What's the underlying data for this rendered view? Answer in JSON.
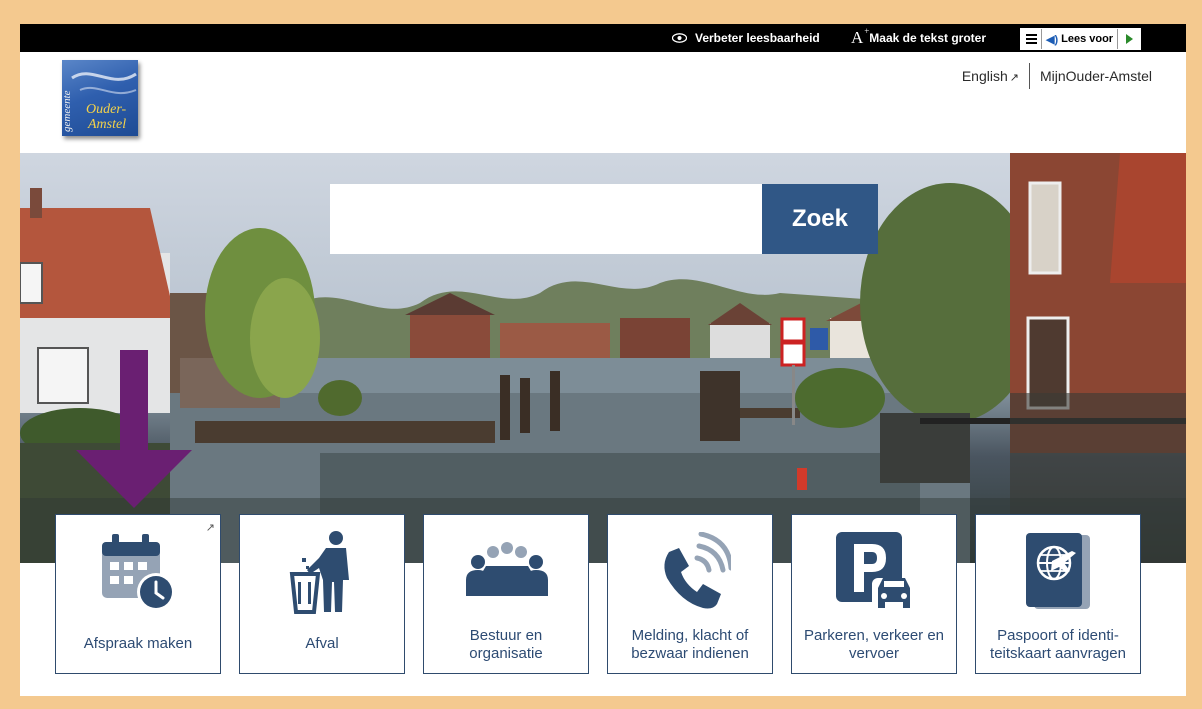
{
  "topbar": {
    "readability": "Verbeter leesbaarheid",
    "larger_text": "Maak de tekst groter",
    "larger_text_glyph": "A",
    "readspeaker_label": "Lees voor"
  },
  "header": {
    "logo_text": [
      "gemeente",
      "Ouder-",
      "Amstel"
    ],
    "links": [
      {
        "label": "English",
        "external": true
      },
      {
        "label": "MijnOuder-Amstel"
      }
    ]
  },
  "search": {
    "value": "",
    "placeholder": "",
    "button_label": "Zoek"
  },
  "tiles": [
    {
      "label": "Afspraak maken",
      "icon": "calendar-clock-icon",
      "external": true
    },
    {
      "label": "Afval",
      "icon": "waste-bin-person-icon"
    },
    {
      "label_lines": [
        "Bestuur en",
        "organisatie"
      ],
      "icon": "meeting-table-icon"
    },
    {
      "label_lines": [
        "Melding, klacht of",
        "bezwaar indienen"
      ],
      "icon": "phone-call-icon"
    },
    {
      "label_lines": [
        "Parkeren, verkeer en",
        "vervoer"
      ],
      "icon": "parking-car-icon"
    },
    {
      "label_lines": [
        "Paspoort of identi-",
        "teitskaart aanvragen"
      ],
      "icon": "passport-icon"
    }
  ],
  "colors": {
    "accent": "#305786",
    "annotation_arrow": "#6a1f72",
    "border_frame": "#f4c98f"
  }
}
